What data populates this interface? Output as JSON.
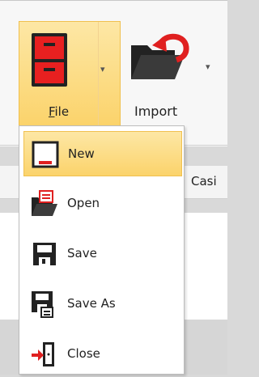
{
  "ribbon": {
    "file_label": "File",
    "import_label": "Import",
    "dropdown_glyph": "▾",
    "casing_text": "Casi"
  },
  "menu": {
    "items": [
      {
        "label": "New",
        "icon": "new-document-icon",
        "active": true
      },
      {
        "label": "Open",
        "icon": "open-folder-icon",
        "active": false
      },
      {
        "label": "Save",
        "icon": "save-disk-icon",
        "active": false
      },
      {
        "label": "Save As",
        "icon": "save-as-disk-icon",
        "active": false
      },
      {
        "label": "Close",
        "icon": "close-door-icon",
        "active": false
      }
    ]
  },
  "colors": {
    "highlight": "#fbd36b",
    "accent_red": "#e02020"
  }
}
